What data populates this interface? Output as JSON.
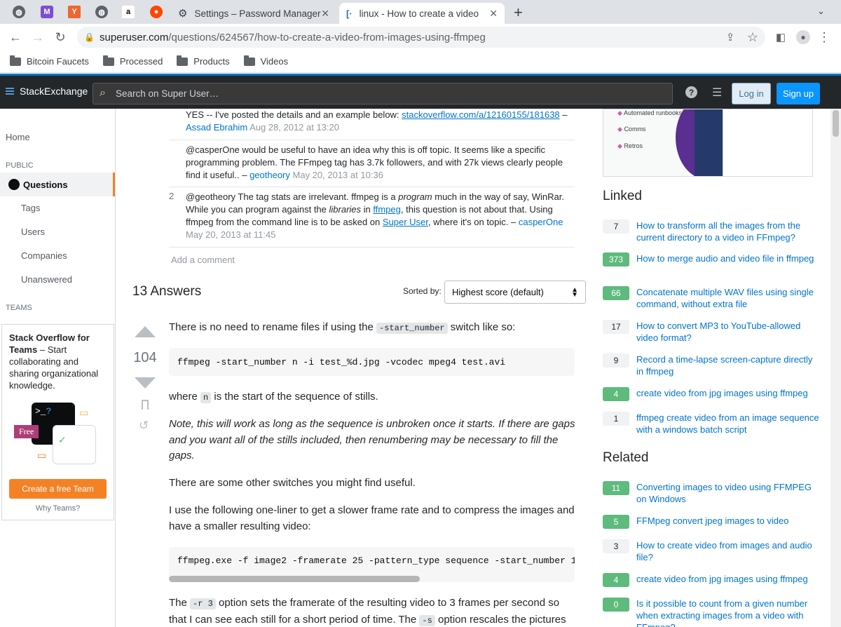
{
  "browser": {
    "tabs": [
      {
        "title": "Settings – Password Manager"
      },
      {
        "title": "linux - How to create a video fro"
      }
    ],
    "url_domain": "superuser.com",
    "url_path": "/questions/624567/how-to-create-a-video-from-images-using-ffmpeg",
    "bookmarks": [
      "Bitcoin Faucets",
      "Processed",
      "Products",
      "Videos"
    ]
  },
  "header": {
    "logo": "StackExchange",
    "search_placeholder": "Search on Super User…",
    "login": "Log in",
    "signup": "Sign up"
  },
  "leftnav": {
    "home": "Home",
    "public": "PUBLIC",
    "questions": "Questions",
    "tags": "Tags",
    "users": "Users",
    "companies": "Companies",
    "unanswered": "Unanswered",
    "teams": "TEAMS",
    "teams_title": "Stack Overflow for Teams",
    "teams_desc": " – Start collaborating and sharing organizational knowledge.",
    "free_badge": "Free",
    "create_team": "Create a free Team",
    "why_teams": "Why Teams?"
  },
  "comments": [
    {
      "text": "YES -- I've posted the details and an example below: ",
      "link": "stackoverflow.com/a/12160155/181638",
      "user": "Assad Ebrahim",
      "date": "Aug 28, 2012 at 13:20"
    },
    {
      "text": "@casperOne would be useful to have an idea why this is off topic. It seems like a specific programming problem. The FFmpeg tag has 3.7k followers, and with 27k views clearly people find it useful.. – ",
      "user": "geotheory",
      "date": "May 20, 2013 at 10:36"
    },
    {
      "score": "2",
      "user": "casperOne",
      "date": "May 20, 2013 at 11:45"
    }
  ],
  "add_comment": "Add a comment",
  "answers": {
    "count_label": "13 Answers",
    "sorted_by": "Sorted by:",
    "sort_value": "Highest score (default)",
    "vote_count": "104",
    "p1_a": "There is no need to rename files if using the ",
    "p1_code": "-start_number",
    "p1_b": " switch like so:",
    "code1": "ffmpeg -start_number n -i test_%d.jpg -vcodec mpeg4 test.avi",
    "p2_a": "where ",
    "p2_code": "n",
    "p2_b": " is the start of the sequence of stills.",
    "p3": "Note, this will work as long as the sequence is unbroken once it starts. If there are gaps and you want all of the stills included, then renumbering may be necessary to fill the gaps.",
    "p4": "There are some other switches you might find useful.",
    "p5": "I use the following one-liner to get a slower frame rate and to compress the images and have a smaller resulting video:",
    "code2": "ffmpeg.exe -f image2 -framerate 25 -pattern_type sequence -start_number 1",
    "p6_a": "The ",
    "p6_code": "-r 3",
    "p6_b": " option sets the framerate of the resulting video to 3 frames per second so that I can see each still for a short period of time. The ",
    "p6_code2": "-s",
    "p6_c": " option rescales the pictures"
  },
  "sidebar": {
    "ad_items": [
      "Automated runbooks",
      "Comms",
      "Retros"
    ],
    "linked_title": "Linked",
    "linked": [
      {
        "score": "7",
        "title": "How to transform all the images from the current directory to a video in FFmpeg?",
        "accepted": false
      },
      {
        "score": "373",
        "title": "How to merge audio and video file in ffmpeg",
        "accepted": true
      },
      {
        "score": "66",
        "title": "Concatenate multiple WAV files using single command, without extra file",
        "accepted": true
      },
      {
        "score": "17",
        "title": "How to convert MP3 to YouTube-allowed video format?",
        "accepted": false
      },
      {
        "score": "9",
        "title": "Record a time-lapse screen-capture directly in ffmpeg",
        "accepted": false
      },
      {
        "score": "4",
        "title": "create video from jpg images using ffmpeg",
        "accepted": true
      },
      {
        "score": "1",
        "title": "ffmpeg create video from an image sequence with a windows batch script",
        "accepted": false
      }
    ],
    "related_title": "Related",
    "related": [
      {
        "score": "11",
        "title": "Converting images to video using FFMPEG on Windows",
        "accepted": true
      },
      {
        "score": "5",
        "title": "FFMpeg convert jpeg images to video",
        "accepted": true
      },
      {
        "score": "3",
        "title": "How to create video from images and audio file?",
        "accepted": false
      },
      {
        "score": "4",
        "title": "create video from jpg images using ffmpeg",
        "accepted": true
      },
      {
        "score": "0",
        "title": "Is it possible to count from a given number when extracting images from a video with FFmpeg?",
        "accepted": true
      }
    ]
  }
}
